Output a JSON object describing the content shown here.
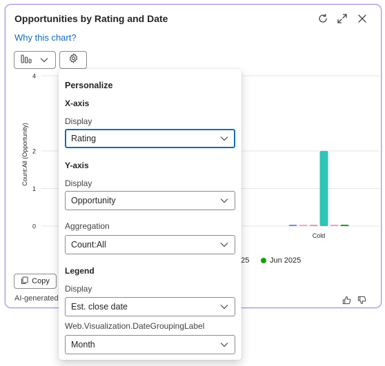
{
  "card": {
    "title": "Opportunities by Rating and Date",
    "why_link": "Why this chart?",
    "copy_label": "Copy",
    "ai_note": "AI-generated"
  },
  "chart_data": {
    "type": "bar",
    "ylabel": "Count:All (Opportunity)",
    "ylim": [
      0,
      4
    ],
    "yticks": [
      "0",
      "1",
      "2",
      "4"
    ],
    "categories": [
      "Cold"
    ],
    "series": [
      {
        "name": "",
        "color": "#6f8fe6",
        "values": [
          0
        ]
      },
      {
        "name": "",
        "color": "#f3a6cf",
        "values": [
          0
        ]
      },
      {
        "name": "",
        "color": "#e995c9",
        "values": [
          0
        ]
      },
      {
        "name": "",
        "color": "#2ec4b6",
        "values": [
          2
        ]
      },
      {
        "name": "",
        "color": "#e7a1cf",
        "values": [
          0
        ]
      },
      {
        "name": "Jun 2025",
        "color": "#13a10e",
        "values": [
          0
        ]
      }
    ],
    "legend_partial_text": "025",
    "grid": true
  },
  "panel": {
    "title": "Personalize",
    "xaxis": {
      "heading": "X-axis",
      "display_label": "Display",
      "display_value": "Rating"
    },
    "yaxis": {
      "heading": "Y-axis",
      "display_label": "Display",
      "display_value": "Opportunity",
      "aggregation_label": "Aggregation",
      "aggregation_value": "Count:All"
    },
    "legend": {
      "heading": "Legend",
      "display_label": "Display",
      "display_value": "Est. close date",
      "grouping_label": "Web.Visualization.DateGroupingLabel",
      "grouping_value": "Month"
    }
  },
  "colors": {
    "accent": "#0f6cbd",
    "border": "#b08ee0",
    "teal_bar": "#2ec4b6"
  },
  "icons": [
    "refresh-icon",
    "expand-icon",
    "close-icon",
    "bar-chart-icon",
    "chevron-down-icon",
    "gear-icon",
    "copy-icon",
    "thumbs-up-icon",
    "thumbs-down-icon"
  ]
}
